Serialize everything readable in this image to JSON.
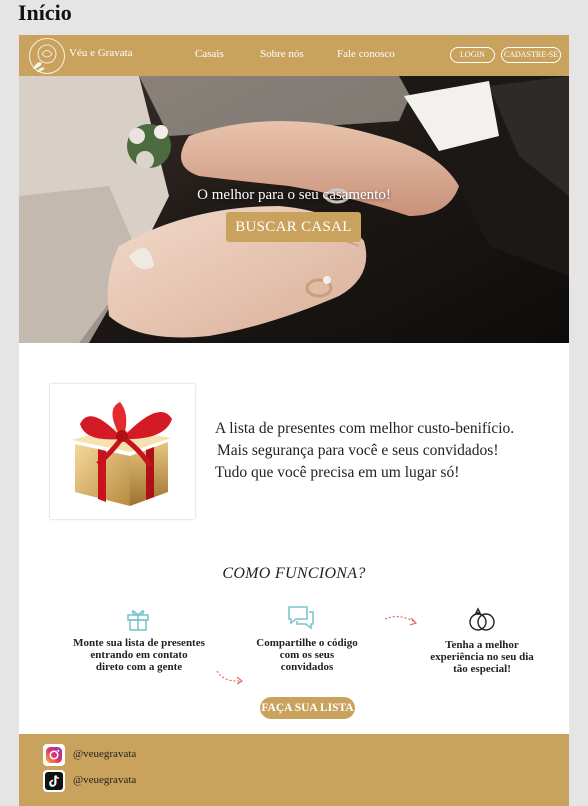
{
  "page": {
    "label": "Início"
  },
  "header": {
    "brand": "Véu e Gravata",
    "nav": [
      "Casais",
      "Sobre nós",
      "Fale conosco"
    ],
    "login_label": "LOGIN",
    "signup_label": "CADASTRE-SE"
  },
  "hero": {
    "title": "O melhor para o seu casamento!",
    "button_label": "BUSCAR CASAL"
  },
  "promo": {
    "lines": [
      "A lista de presentes com melhor custo-benifício.",
      "Mais segurança para você e seus convidados!",
      "Tudo que você precisa em um lugar só!"
    ]
  },
  "how": {
    "title": "COMO FUNCIONA?",
    "steps": [
      {
        "icon": "gift-icon",
        "lines": [
          "Monte sua lista de presentes",
          "entrando em contato",
          "direto com a gente"
        ]
      },
      {
        "icon": "chat-icon",
        "lines": [
          "Compartilhe o código",
          "com os seus",
          "convidados"
        ]
      },
      {
        "icon": "rings-icon",
        "lines": [
          "Tenha a melhor",
          "experiência no seu dia",
          "tão especial!"
        ]
      }
    ],
    "cta_label": "FAÇA SUA LISTA"
  },
  "footer": {
    "instagram": {
      "icon": "instagram-icon",
      "handle": "@veuegravata"
    },
    "tiktok": {
      "icon": "tiktok-icon",
      "handle": "@veuegravata"
    }
  },
  "colors": {
    "accent": "#c9a25e",
    "icon_teal": "#7ec4cf",
    "arrow_red": "#e05a5a"
  }
}
